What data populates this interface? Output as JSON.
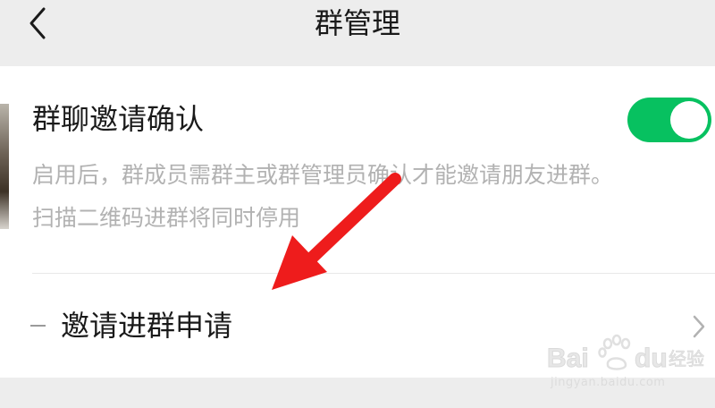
{
  "header": {
    "title": "群管理",
    "back_icon": "chevron-left-icon"
  },
  "settings": {
    "invite_confirm": {
      "label": "群聊邀请确认",
      "toggle_on": true,
      "description_line1": "启用后，群成员需群主或群管理员确认才能邀请朋友进群。",
      "description_line2": "扫描二维码进群将同时停用"
    },
    "invite_requests": {
      "label": "邀请进群申请",
      "chevron_icon": "chevron-right-icon"
    }
  },
  "annotation": {
    "arrow_color": "#ee1c1c"
  },
  "watermark": {
    "brand": "Bai du 经验",
    "url": "jingyan.baidu.com"
  },
  "colors": {
    "accent": "#07c160",
    "background": "#ededed",
    "card": "#ffffff",
    "secondary_text": "#b2b2b2"
  }
}
